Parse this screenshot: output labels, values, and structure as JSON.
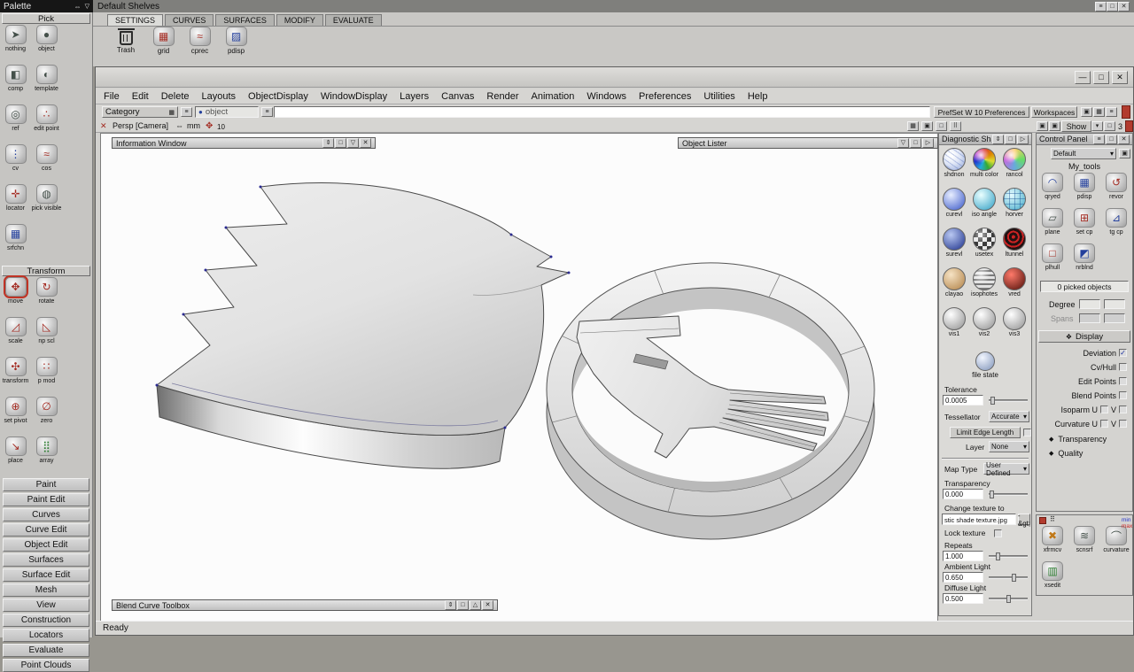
{
  "icons": {
    "minimize": "—",
    "maximize": "□",
    "close": "✕",
    "resize": "⇕",
    "shade_down": "▽",
    "shade_up": "△",
    "arrow_right": "▷",
    "dropdown": "▾",
    "double_arrow": "⇔",
    "menu": "≡",
    "grid": "▦",
    "box": "▣",
    "dots": "⠿",
    "sphere": "●",
    "diamond": "◆",
    "display": "❖",
    "check": "✓",
    "move_cursor": "✥"
  },
  "palette": {
    "title": "Palette",
    "pick_header": "Pick",
    "transform_header": "Transform",
    "pick": [
      {
        "label": "nothing",
        "g": "➤"
      },
      {
        "label": "object",
        "g": "●"
      },
      {
        "label": "comp",
        "g": "◧"
      },
      {
        "label": "template",
        "g": "◐"
      },
      {
        "label": "ref",
        "g": "◎"
      },
      {
        "label": "edit point",
        "g": "∴"
      },
      {
        "label": "cv",
        "g": "⋮"
      },
      {
        "label": "cos",
        "g": "≈"
      },
      {
        "label": "locator",
        "g": "✛"
      },
      {
        "label": "pick visible",
        "g": "◍"
      },
      {
        "label": "srfchn",
        "g": "▦"
      }
    ],
    "transform": [
      {
        "label": "move",
        "g": "✥"
      },
      {
        "label": "rotate",
        "g": "↻"
      },
      {
        "label": "scale",
        "g": "◿"
      },
      {
        "label": "np scl",
        "g": "◺"
      },
      {
        "label": "transform",
        "g": "✣"
      },
      {
        "label": "p mod",
        "g": "∷"
      },
      {
        "label": "set pivot",
        "g": "⊕"
      },
      {
        "label": "zero",
        "g": "∅"
      },
      {
        "label": "place",
        "g": "↘"
      },
      {
        "label": "array",
        "g": "⣿"
      }
    ],
    "buttons": [
      "Paint",
      "Paint Edit",
      "Curves",
      "Curve Edit",
      "Object Edit",
      "Surfaces",
      "Surface Edit",
      "Mesh",
      "View",
      "Construction",
      "Locators",
      "Evaluate",
      "Point Clouds"
    ]
  },
  "shelves": {
    "title": "Default Shelves",
    "tabs": [
      "SETTINGS",
      "CURVES",
      "SURFACES",
      "MODIFY",
      "EVALUATE"
    ],
    "tools": [
      {
        "label": "Trash"
      },
      {
        "label": "grid",
        "g": "▦"
      },
      {
        "label": "cprec",
        "g": "≈"
      },
      {
        "label": "pdisp",
        "g": "▨"
      }
    ]
  },
  "menu": [
    "File",
    "Edit",
    "Delete",
    "Layouts",
    "ObjectDisplay",
    "WindowDisplay",
    "Layers",
    "Canvas",
    "Render",
    "Animation",
    "Windows",
    "Preferences",
    "Utilities",
    "Help"
  ],
  "toolbar": {
    "category": "Category",
    "object": "object",
    "prefset": "PrefSet W 10 Preferences",
    "workspaces": "Workspaces"
  },
  "perspbar": {
    "camera": "Persp [Camera]",
    "units": "mm",
    "value": "10",
    "show": "Show",
    "count": "3"
  },
  "viewport": {
    "information_window": "Information Window",
    "object_lister": "Object Lister",
    "blend_toolbox": "Blend Curve Toolbox"
  },
  "diagnostic": {
    "title": "Diagnostic Shade",
    "shaders": [
      "shdnon",
      "multi color",
      "rancol",
      "curevl",
      "iso angle",
      "horver",
      "surevl",
      "usetex",
      "ltunnel",
      "clayao",
      "isophotes",
      "vred",
      "vis1",
      "vis2",
      "vis3"
    ],
    "file_state": "file state",
    "tolerance_label": "Tolerance",
    "tolerance": "0.0005",
    "tessellator_label": "Tessellator",
    "tessellator": "Accurate",
    "limit_edge": "Limit Edge Length",
    "layer_label": "Layer",
    "layer": "None",
    "map_type_label": "Map Type",
    "map_type": "User Defined",
    "transparency_label": "Transparency",
    "transparency": "0.000",
    "change_texture": "Change texture to",
    "texture_file": "stic shade texture.jpg",
    "texture_btn": "-&gt;",
    "lock_texture": "Lock texture",
    "repeats_label": "Repeats",
    "repeats": "1.000",
    "ambient_label": "Ambient Light",
    "ambient": "0.650",
    "diffuse_label": "Diffuse Light",
    "diffuse": "0.500"
  },
  "control": {
    "title": "Control Panel",
    "preset": "Default",
    "my_tools": "My_tools",
    "tools": [
      {
        "label": "qryed",
        "g": "◠"
      },
      {
        "label": "pdisp",
        "g": "▦"
      },
      {
        "label": "revor",
        "g": "↺"
      },
      {
        "label": "plane",
        "g": "▱"
      },
      {
        "label": "set cp",
        "g": "⊞"
      },
      {
        "label": "tg cp",
        "g": "⊿"
      },
      {
        "label": "plhull",
        "g": "□"
      },
      {
        "label": "nrblnd",
        "g": "◩"
      }
    ],
    "picked": "0 picked objects",
    "degree": "Degree",
    "spans": "Spans",
    "display": "Display",
    "checks": [
      "Deviation",
      "Cv/Hull",
      "Edit Points",
      "Blend Points",
      "Isoparm U",
      "Curvature U"
    ],
    "v_label": "V",
    "transparency": "Transparency",
    "quality": "Quality",
    "bottom_tools": [
      {
        "label": "xfrmcv",
        "g": "✖"
      },
      {
        "label": "scnsrf",
        "g": "≋"
      },
      {
        "label": "curvature",
        "g": "⌒"
      },
      {
        "label": "xsedit",
        "g": "▥"
      }
    ],
    "min": "min",
    "max": "max"
  },
  "status": "Ready"
}
